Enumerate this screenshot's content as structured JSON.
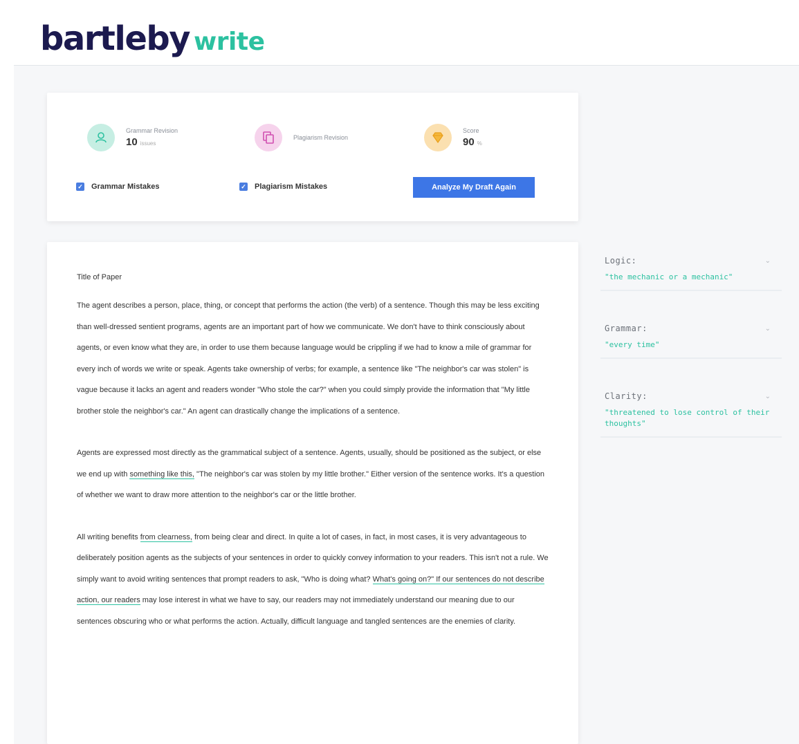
{
  "brand": {
    "name": "bartleby",
    "product": "write"
  },
  "summary": {
    "grammar": {
      "label": "Grammar Revision",
      "value": "10",
      "unit": "issues"
    },
    "plagiarism": {
      "label": "Plagiarism Revision"
    },
    "score": {
      "label": "Score",
      "value": "90",
      "unit": "%"
    },
    "check_grammar": "Grammar Mistakes",
    "check_plagiarism": "Plagiarism Mistakes",
    "analyze_button": "Analyze My Draft Again"
  },
  "document": {
    "title": "Title of Paper",
    "p1": "The agent describes a person, place, thing, or concept that performs the action (the verb) of a sentence. Though this may be less exciting than well-dressed sentient programs, agents are an important part of how we communicate. We don't have to think consciously about agents, or even know what they are, in order to use them because language would be crippling if we had to know a mile of grammar for every inch of words we write or speak. Agents take ownership of verbs; for example, a sentence like \"The neighbor's car was stolen\" is vague because it lacks an agent and readers wonder \"Who stole the car?\" when you could simply provide the information that \"My little brother stole the neighbor's car.\" An agent can drastically change the implications of a sentence.",
    "p2_a": "Agents are expressed most directly as the grammatical subject of a sentence. Agents, usually, should be positioned as the subject, or else we end up with ",
    "p2_hl": "something like this,",
    "p2_b": " \"The neighbor's car was stolen by my little brother.\" Either version of the sentence works. It's a question of whether we want to draw more attention to the neighbor's car or the little brother.",
    "p3_a": "All writing benefits ",
    "p3_hl1": "from clearness,",
    "p3_b": " from being clear and direct. In quite a lot of cases, in fact, in most cases, it is very advantageous to deliberately position agents as the subjects of your sentences in order to quickly convey information to your readers. This isn't not a rule. We simply want to avoid writing sentences that prompt readers to ask, \"Who is doing what? ",
    "p3_hl2": "What's going on?\" If our sentences do not describe action, our readers",
    "p3_c": " may lose interest in what we have to say, our readers may not immediately understand our meaning due to our sentences obscuring who or what performs the action. Actually, difficult language and tangled sentences are the enemies of clarity."
  },
  "suggestions": [
    {
      "title": "Logic:",
      "text": "\"the mechanic or a mechanic\""
    },
    {
      "title": "Grammar:",
      "text": "\"every time\""
    },
    {
      "title": "Clarity:",
      "text": "\"threatened to lose control of their thoughts\""
    }
  ],
  "colors": {
    "brand_navy": "#1c1a4f",
    "brand_green": "#2cc1a0",
    "button_blue": "#3d76e6"
  }
}
